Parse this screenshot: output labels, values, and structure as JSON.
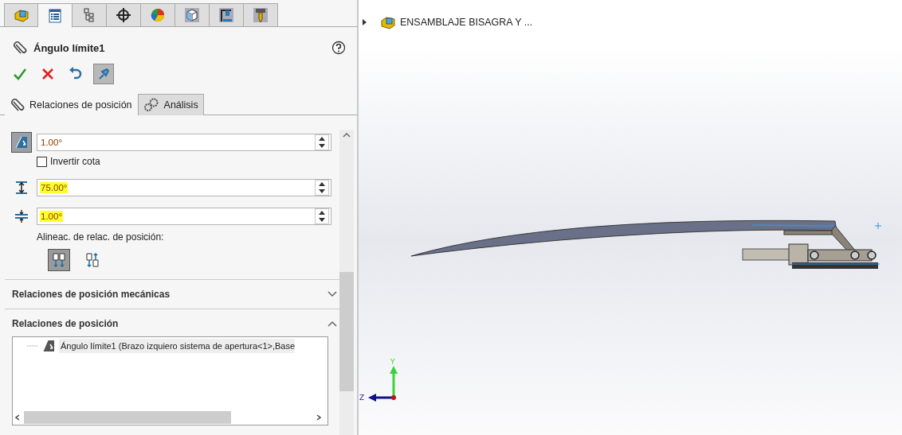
{
  "tabs": [
    {
      "kind": "assembly",
      "selected": false
    },
    {
      "kind": "properties",
      "selected": true
    },
    {
      "kind": "configurations",
      "selected": false
    },
    {
      "kind": "dimxpert",
      "selected": false
    },
    {
      "kind": "appearance",
      "selected": false
    },
    {
      "kind": "display",
      "selected": false
    },
    {
      "kind": "press",
      "selected": false
    },
    {
      "kind": "tool",
      "selected": false
    }
  ],
  "property_manager": {
    "title": "Ángulo límite1",
    "pin_pressed": true
  },
  "subtabs": [
    {
      "label": "Relaciones de posición",
      "kind": "mates",
      "selected": true
    },
    {
      "label": "Análisis",
      "kind": "analysis",
      "selected": false
    }
  ],
  "fields": [
    {
      "kind": "angle",
      "value": "1.00°",
      "highlighted": false
    },
    {
      "kind": "max",
      "value": "75.00°",
      "highlighted": true
    },
    {
      "kind": "min",
      "value": "1.00°",
      "highlighted": true
    }
  ],
  "invert": {
    "label": "Invertir cota",
    "checked": false
  },
  "alignment": {
    "label": "Alineac. de relac. de posición:",
    "options": [
      {
        "kind": "aligned",
        "selected": true
      },
      {
        "kind": "anti_aligned",
        "selected": false
      }
    ]
  },
  "sections": [
    {
      "title": "Relaciones de posición mecánicas",
      "expanded": false
    },
    {
      "title": "Relaciones de posición",
      "expanded": true,
      "items": [
        "Ángulo límite1 (Brazo izquiero sistema de apertura<1>,Base"
      ]
    }
  ],
  "viewport": {
    "tree_item": {
      "label": "ENSAMBLAJE BISAGRA Y ...",
      "expanded": false
    },
    "triad": {
      "y_label": "Y",
      "z_label": "Z"
    }
  }
}
